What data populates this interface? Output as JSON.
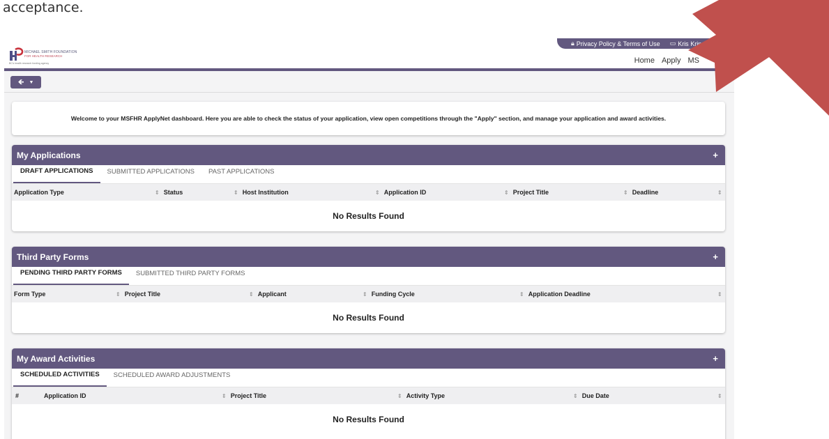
{
  "document": {
    "top_text": "acceptance."
  },
  "header": {
    "logo": {
      "line1": "MICHAEL SMITH FOUNDATION",
      "line2": "FOR HEALTH RESEARCH",
      "line3": "BC's health research funding agency"
    },
    "util": {
      "privacy": "Privacy Policy & Terms of Use",
      "user": "Kris Kringl"
    },
    "nav": [
      "Home",
      "Apply",
      "MS"
    ]
  },
  "toolbar": {
    "back_icon": "arrow-left-icon",
    "dropdown_icon": "caret-down-icon"
  },
  "welcome": "Welcome to your MSFHR ApplyNet dashboard. Here you are able to check the status of your application, view open competitions through the \"Apply\" section, and manage your application and award activities.",
  "panels": [
    {
      "title": "My Applications",
      "tabs": [
        "DRAFT APPLICATIONS",
        "SUBMITTED APPLICATIONS",
        "PAST APPLICATIONS"
      ],
      "columns": [
        "Application Type",
        "Status",
        "Host Institution",
        "Application ID",
        "Project Title",
        "Deadline"
      ],
      "empty": "No Results Found"
    },
    {
      "title": "Third Party Forms",
      "tabs": [
        "PENDING THIRD PARTY FORMS",
        "SUBMITTED THIRD PARTY FORMS"
      ],
      "columns": [
        "Form Type",
        "Project Title",
        "Applicant",
        "Funding Cycle",
        "Application Deadline"
      ],
      "empty": "No Results Found"
    },
    {
      "title": "My Award Activities",
      "tabs": [
        "SCHEDULED ACTIVITIES",
        "SCHEDULED AWARD ADJUSTMENTS"
      ],
      "columns": [
        "#",
        "Application ID",
        "Project Title",
        "Activity Type",
        "Due Date"
      ],
      "empty": "No Results Found"
    }
  ],
  "colors": {
    "accent": "#62587f",
    "arrow": "#c0504d"
  }
}
